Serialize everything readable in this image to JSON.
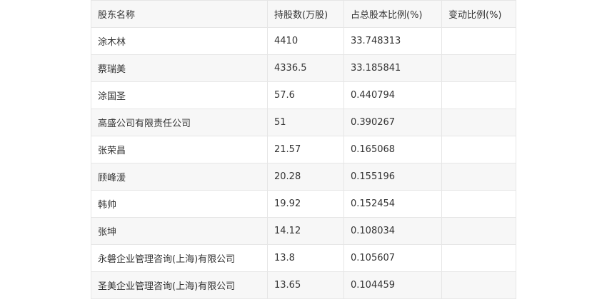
{
  "table": {
    "headers": [
      "股东名称",
      "持股数(万股)",
      "占总股本比例(%)",
      "变动比例(%)"
    ],
    "rows": [
      [
        "涂木林",
        "4410",
        "33.748313",
        ""
      ],
      [
        "蔡瑞美",
        "4336.5",
        "33.185841",
        ""
      ],
      [
        "涂国圣",
        "57.6",
        "0.440794",
        ""
      ],
      [
        "高盛公司有限责任公司",
        "51",
        "0.390267",
        ""
      ],
      [
        "张荣昌",
        "21.57",
        "0.165068",
        ""
      ],
      [
        "顾峰湲",
        "20.28",
        "0.155196",
        ""
      ],
      [
        "韩帅",
        "19.92",
        "0.152454",
        ""
      ],
      [
        "张坤",
        "14.12",
        "0.108034",
        ""
      ],
      [
        "永磐企业管理咨询(上海)有限公司",
        "13.8",
        "0.105607",
        ""
      ],
      [
        "圣美企业管理咨询(上海)有限公司",
        "13.65",
        "0.104459",
        ""
      ]
    ]
  }
}
